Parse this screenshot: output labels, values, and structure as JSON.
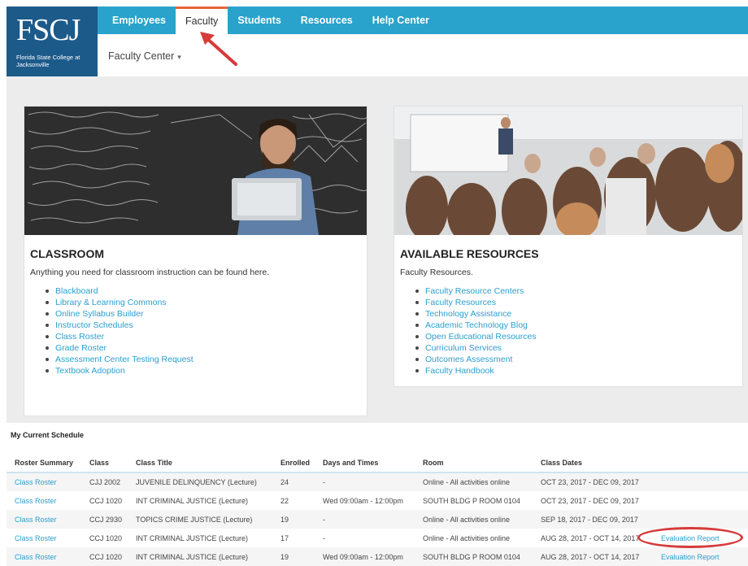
{
  "logo": {
    "mark": "FSCJ",
    "subtitle": "Florida State College at Jacksonville"
  },
  "nav": {
    "items": [
      "Employees",
      "Faculty",
      "Students",
      "Resources",
      "Help Center"
    ],
    "active": "Faculty"
  },
  "subnav": {
    "label": "Faculty Center",
    "caret": "▾"
  },
  "colors": {
    "nav_bg": "#29a3cb",
    "logo_bg": "#1c5a8a",
    "link": "#2b9fd0",
    "annotation": "#d63a3a"
  },
  "classroom": {
    "title": "CLASSROOM",
    "description": "Anything you need for classroom instruction can be found here.",
    "links": [
      "Blackboard",
      "Library & Learning Commons",
      "Online Syllabus Builder",
      "Instructor Schedules",
      "Class Roster",
      "Grade Roster",
      "Assessment Center Testing Request",
      "Textbook Adoption"
    ]
  },
  "resources": {
    "title": "AVAILABLE RESOURCES",
    "description": "Faculty Resources.",
    "links": [
      "Faculty Resource Centers",
      "Faculty Resources",
      "Technology Assistance",
      "Academic Technology Blog",
      "Open Educational Resources",
      "Curriculum Services",
      "Outcomes Assessment",
      "Faculty Handbook"
    ]
  },
  "schedule": {
    "title": "My Current Schedule",
    "columns": [
      "Roster Summary",
      "Class",
      "Class Title",
      "Enrolled",
      "Days and Times",
      "Room",
      "Class Dates",
      ""
    ],
    "rows": [
      [
        "Class Roster",
        "CJJ 2002",
        "JUVENILE DELINQUENCY (Lecture)",
        "24",
        "-",
        "Online - All activities online",
        "OCT 23, 2017 - DEC 09, 2017",
        ""
      ],
      [
        "Class Roster",
        "CCJ 1020",
        "INT CRIMINAL JUSTICE (Lecture)",
        "22",
        "Wed 09:00am - 12:00pm",
        "SOUTH BLDG P ROOM 0104",
        "OCT 23, 2017 - DEC 09, 2017",
        ""
      ],
      [
        "Class Roster",
        "CCJ 2930",
        "TOPICS CRIME JUSTICE (Lecture)",
        "19",
        "-",
        "Online - All activities online",
        "SEP 18, 2017 - DEC 09, 2017",
        ""
      ],
      [
        "Class Roster",
        "CCJ 1020",
        "INT CRIMINAL JUSTICE (Lecture)",
        "17",
        "-",
        "Online - All activities online",
        "AUG 28, 2017 - OCT 14, 2017",
        "Evaluation Report"
      ],
      [
        "Class Roster",
        "CCJ 1020",
        "INT CRIMINAL JUSTICE (Lecture)",
        "19",
        "Wed 09:00am - 12:00pm",
        "SOUTH BLDG P ROOM 0104",
        "AUG 28, 2017 - OCT 14, 2017",
        "Evaluation Report"
      ]
    ]
  }
}
